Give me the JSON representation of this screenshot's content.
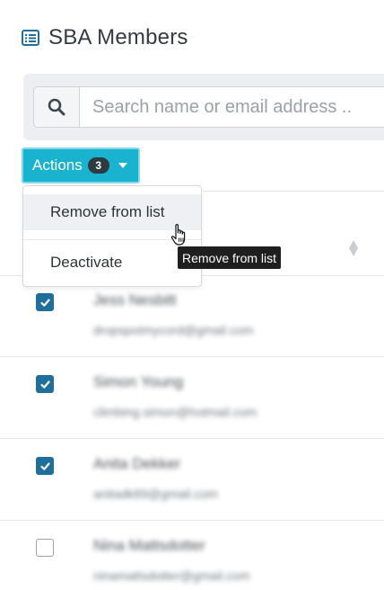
{
  "header": {
    "title": "SBA Members",
    "icon": "list-alt-icon",
    "icon_color": "#1f6f9a"
  },
  "search": {
    "placeholder": "Search name or email address ..",
    "button_icon": "search-icon"
  },
  "actions": {
    "label": "Actions",
    "badge_count": "3",
    "accent_color": "#1ab3cf",
    "menu": [
      {
        "label": "Remove from list",
        "hovered": true
      },
      {
        "label": "Deactivate",
        "hovered": false
      }
    ]
  },
  "tooltip": {
    "text": "Remove from list"
  },
  "members": [
    {
      "name": "Jess Nesbitt",
      "email": "dropspotmycord@gmail.com",
      "checked": true
    },
    {
      "name": "Simon Young",
      "email": "climbing.simon@hotmail.com",
      "checked": true
    },
    {
      "name": "Anita Dekker",
      "email": "anitadk89@gmail.com",
      "checked": true
    },
    {
      "name": "Nina Mattsdotter",
      "email": "ninamattsdotter@gmail.com",
      "checked": false
    }
  ]
}
